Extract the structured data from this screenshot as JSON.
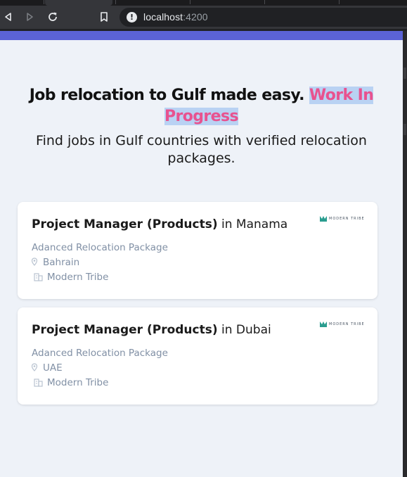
{
  "browser": {
    "url_host": "localhost",
    "url_port": ":4200"
  },
  "hero": {
    "title_main": "Job relocation to Gulf made easy.",
    "title_highlight": "Work In Progress",
    "subtitle": "Find jobs in Gulf countries with verified relocation packages."
  },
  "jobs": [
    {
      "role": "Project Manager (Products)",
      "location_text": "in Manama",
      "package": "Adanced Relocation Package",
      "country": "Bahrain",
      "company": "Modern Tribe",
      "logo_text": "MODERN TRIBE"
    },
    {
      "role": "Project Manager (Products)",
      "location_text": "in Dubai",
      "package": "Adanced Relocation Package",
      "country": "UAE",
      "company": "Modern Tribe",
      "logo_text": "MODERN TRIBE"
    }
  ],
  "colors": {
    "accent_bar": "#5b63d6",
    "highlight_text": "#e8528f",
    "highlight_bg": "#b9d2f3",
    "logo_mark": "#2a9d8f"
  }
}
